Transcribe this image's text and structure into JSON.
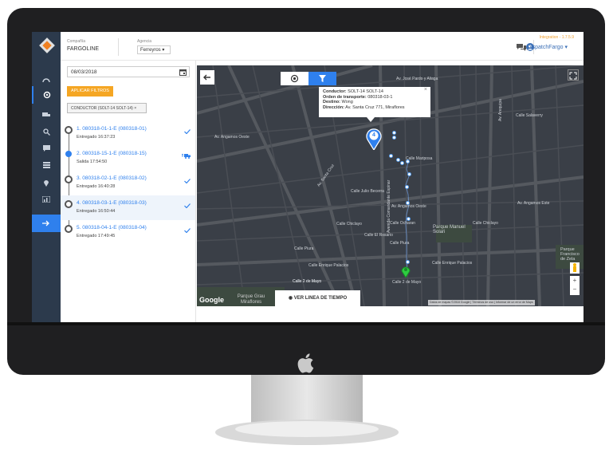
{
  "colors": {
    "accent": "#2f80ed",
    "apply": "#f5a623",
    "nav_bg": "#2c3a4c",
    "map_bg": "#3a3f47",
    "marker_green": "#2ecc40"
  },
  "header": {
    "company_label": "Compañía",
    "company_value": "FARGOLINE",
    "agency_label": "Agencia",
    "agency_value": "Ferreyros",
    "version": "Integration - 1.7.5.9",
    "user": "DispatchFargo"
  },
  "panel": {
    "date": "08/03/2018",
    "apply_label": "APLICAR FILTROS",
    "chip_label": "CONDUCTOR (SOLT-14 SOLT-14)",
    "stops": [
      {
        "title": "1. 080318-01-1-E (080318-01)",
        "subtitle": "Entregado 16:37:23",
        "status": "check"
      },
      {
        "title": "2. 080318-15-1-E (080318-15)",
        "subtitle": "Salida 17:54:50",
        "status": "truck"
      },
      {
        "title": "3. 080318-02-1-E (080318-02)",
        "subtitle": "Entregado 16:40:28",
        "status": "check"
      },
      {
        "title": "4. 080318-03-1-E (080318-03)",
        "subtitle": "Entregado 16:50:44",
        "status": "check"
      },
      {
        "title": "5. 080318-04-1-E (080318-04)",
        "subtitle": "Entregado 17:49:45",
        "status": "check"
      }
    ]
  },
  "map": {
    "info": {
      "conductor_label": "Conductor:",
      "conductor": "SOLT-14 SOLT-14",
      "orden_label": "Orden de transporte:",
      "orden": "080318-03-1",
      "destino_label": "Destino:",
      "destino": "Wong",
      "direccion_label": "Dirección:",
      "direccion": "Av. Santa Cruz 771, Miraflores"
    },
    "marker_number": "4",
    "timeline_button": "VER LINEA DE TIEMPO",
    "google": "Google",
    "park_label": "Parque Grau Miraflores",
    "attribution": "Datos de mapas ©2018 Google | Términos de uso | Informar de un error de Maps",
    "labels": {
      "pardo": "Av. José Pardo y Aliaga",
      "angamos_o": "Av. Angamos Oeste",
      "angamos_e": "Av. Angamos Este",
      "enrique": "Calle Enrique Palacios",
      "dos_mayo": "Calle 2 de Mayo",
      "dos_mayo2": "Calle 2 de Mayo",
      "piura": "Calle Piura",
      "chiclayo": "Calle Chiclayo",
      "parque": "Parque Manuel Solari",
      "salaverry": "Calle Salaverry",
      "comandante": "Avenida Comandante Espinar",
      "julio": "Calle Julio Becerra",
      "parque_francisco": "Parque Francisco de Zela",
      "arequipa": "Av. Arequipa",
      "santa_cruz": "Av. Santa Cruz",
      "angamos_o2": "Av. Angamos Oeste",
      "ocharan": "Calle Ocharan",
      "el_rosario": "Calle El Rosario",
      "chiclayo2": "Calle Chiclayo",
      "piura2": "Calle Piura",
      "enrique2": "Calle Enrique Palacios",
      "dos_mayo3": "Calle 2 de Mayo",
      "mariposa": "Calle Mariposa"
    }
  }
}
